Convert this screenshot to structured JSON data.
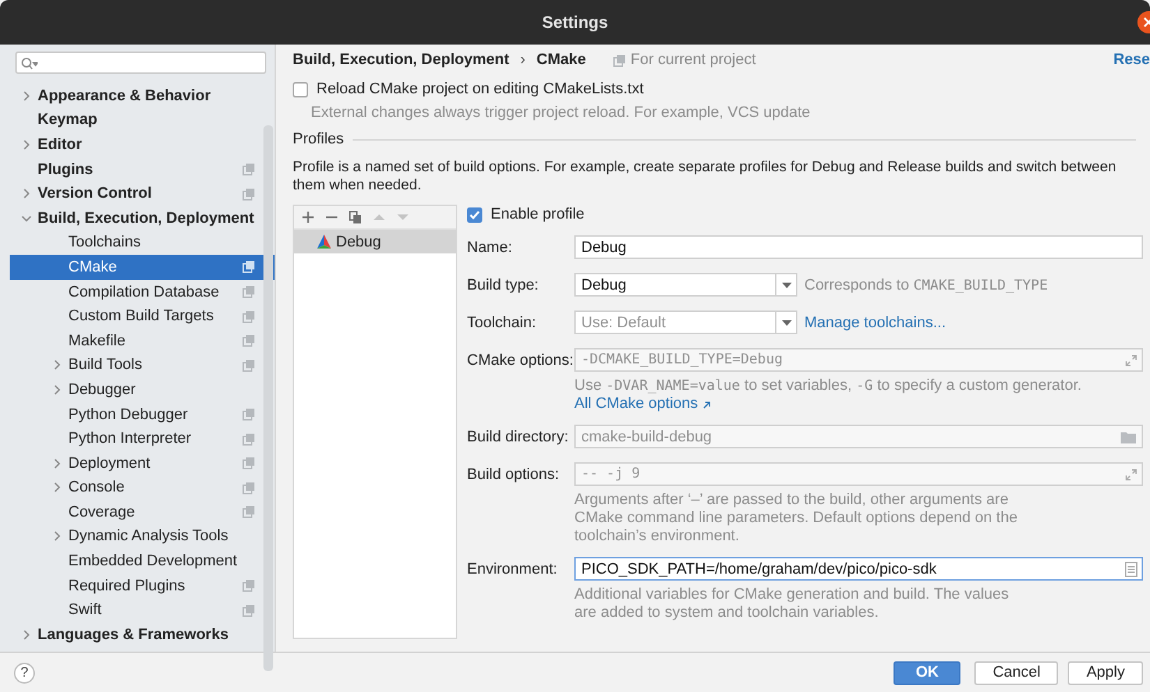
{
  "window": {
    "title": "Settings"
  },
  "sidebar": {
    "items": [
      {
        "label": "Appearance & Behavior",
        "kind": "folder",
        "expanded": false,
        "selected": false,
        "project_scope": false
      },
      {
        "label": "Keymap",
        "kind": "page",
        "selected": false,
        "project_scope": false
      },
      {
        "label": "Editor",
        "kind": "folder",
        "expanded": false,
        "selected": false,
        "project_scope": false
      },
      {
        "label": "Plugins",
        "kind": "page",
        "selected": false,
        "project_scope": true
      },
      {
        "label": "Version Control",
        "kind": "folder",
        "expanded": false,
        "selected": false,
        "project_scope": true
      },
      {
        "label": "Build, Execution, Deployment",
        "kind": "folder",
        "expanded": true,
        "selected": false,
        "project_scope": false,
        "children": [
          {
            "label": "Toolchains",
            "kind": "page",
            "selected": false,
            "project_scope": false
          },
          {
            "label": "CMake",
            "kind": "page",
            "selected": true,
            "project_scope": true
          },
          {
            "label": "Compilation Database",
            "kind": "page",
            "selected": false,
            "project_scope": true
          },
          {
            "label": "Custom Build Targets",
            "kind": "page",
            "selected": false,
            "project_scope": true
          },
          {
            "label": "Makefile",
            "kind": "page",
            "selected": false,
            "project_scope": true
          },
          {
            "label": "Build Tools",
            "kind": "folder",
            "expanded": false,
            "selected": false,
            "project_scope": true
          },
          {
            "label": "Debugger",
            "kind": "folder",
            "expanded": false,
            "selected": false,
            "project_scope": false
          },
          {
            "label": "Python Debugger",
            "kind": "page",
            "selected": false,
            "project_scope": true
          },
          {
            "label": "Python Interpreter",
            "kind": "page",
            "selected": false,
            "project_scope": true
          },
          {
            "label": "Deployment",
            "kind": "folder",
            "expanded": false,
            "selected": false,
            "project_scope": true
          },
          {
            "label": "Console",
            "kind": "folder",
            "expanded": false,
            "selected": false,
            "project_scope": true
          },
          {
            "label": "Coverage",
            "kind": "page",
            "selected": false,
            "project_scope": true
          },
          {
            "label": "Dynamic Analysis Tools",
            "kind": "folder",
            "expanded": false,
            "selected": false,
            "project_scope": false
          },
          {
            "label": "Embedded Development",
            "kind": "page",
            "selected": false,
            "project_scope": false
          },
          {
            "label": "Required Plugins",
            "kind": "page",
            "selected": false,
            "project_scope": true
          },
          {
            "label": "Swift",
            "kind": "page",
            "selected": false,
            "project_scope": true
          }
        ]
      },
      {
        "label": "Languages & Frameworks",
        "kind": "folder",
        "expanded": false,
        "selected": false,
        "project_scope": false
      }
    ]
  },
  "header": {
    "breadcrumb": [
      "Build, Execution, Deployment",
      "CMake"
    ],
    "separator": "›",
    "scope": "For current project",
    "reset": "Rese"
  },
  "reload": {
    "label": "Reload CMake project on editing CMakeLists.txt",
    "checked": false,
    "hint": "External changes always trigger project reload. For example, VCS update"
  },
  "profiles": {
    "title": "Profiles",
    "description": "Profile is a named set of build options. For example, create separate profiles for Debug and Release builds and switch between them when needed.",
    "toolbar": [
      {
        "kind": "add",
        "disabled": false
      },
      {
        "kind": "remove",
        "disabled": false
      },
      {
        "kind": "copy",
        "disabled": false
      },
      {
        "kind": "up",
        "disabled": true
      },
      {
        "kind": "down",
        "disabled": true
      }
    ],
    "list": [
      {
        "name": "Debug",
        "selected": true
      }
    ],
    "enable": {
      "label": "Enable profile",
      "checked": true
    },
    "fields": [
      {
        "label": "Name:",
        "kind": "text",
        "value": "Debug"
      },
      {
        "label": "Build type:",
        "kind": "select",
        "value": "Debug",
        "note": [
          {
            "text": "Corresponds to "
          },
          {
            "text": "CMAKE_BUILD_TYPE",
            "mono": true
          }
        ]
      },
      {
        "label": "Toolchain:",
        "kind": "select",
        "placeholder": "Use: Default",
        "link": "Manage toolchains..."
      },
      {
        "label": "CMake options:",
        "kind": "expand",
        "placeholder": "-DCMAKE_BUILD_TYPE=Debug",
        "mono": true,
        "hint": [
          {
            "text": "Use "
          },
          {
            "text": "-DVAR_NAME=value",
            "mono": true
          },
          {
            "text": " to set variables, "
          },
          {
            "text": "-G",
            "mono": true
          },
          {
            "text": " to specify a custom generator."
          }
        ],
        "hint_link": "All CMake options"
      },
      {
        "label": "Build directory:",
        "kind": "folder",
        "placeholder": "cmake-build-debug"
      },
      {
        "label": "Build options:",
        "kind": "expand",
        "placeholder": "-- -j 9",
        "mono": true,
        "hint": [
          {
            "text": "Arguments after ‘–’ are passed to the build, other arguments are CMake command line parameters. Default options depend on the toolchain’s environment."
          }
        ]
      },
      {
        "label": "Environment:",
        "kind": "env",
        "value": "PICO_SDK_PATH=/home/graham/dev/pico/pico-sdk",
        "focused": true,
        "hint": [
          {
            "text": "Additional variables for CMake generation and build. The values are added to system and toolchain variables."
          }
        ]
      }
    ]
  },
  "help": "?",
  "buttons": [
    {
      "label": "OK",
      "primary": true
    },
    {
      "label": "Cancel",
      "primary": false
    },
    {
      "label": "Apply",
      "primary": false
    }
  ]
}
